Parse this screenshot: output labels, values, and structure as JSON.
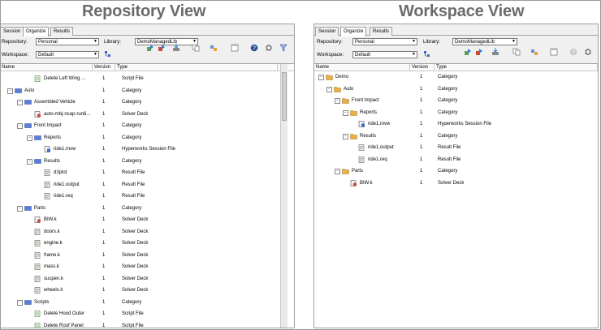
{
  "titles": {
    "left": "Repository View",
    "right": "Workspace View"
  },
  "tabs": [
    "Session",
    "Organize",
    "Results"
  ],
  "controls": {
    "repository_label": "Repository:",
    "repository_value": "Personal",
    "library_label": "Library:",
    "library_value": "DemoManagedLib",
    "workspace_label": "Workspace:",
    "workspace_value": "Default"
  },
  "columns": {
    "name": "Name",
    "version": "Version",
    "type": "Type"
  },
  "left_rows": [
    {
      "name": "Delete Left Wing ...",
      "version": "1",
      "type": "Script File",
      "icon": "script-icon",
      "level": 2
    },
    {
      "name": "Auto",
      "version": "1",
      "type": "Category",
      "icon": "category-icon",
      "level": 0
    },
    {
      "name": "Assembled Vehicle",
      "version": "1",
      "type": "Category",
      "icon": "category-icon",
      "level": 1
    },
    {
      "name": "auto-mbj-ncap-run6...",
      "version": "1",
      "type": "Solver Deck",
      "icon": "solver-deck-icon",
      "level": 2
    },
    {
      "name": "Front Impact",
      "version": "1",
      "type": "Category",
      "icon": "category-icon",
      "level": 1
    },
    {
      "name": "Reports",
      "version": "1",
      "type": "Category",
      "icon": "category-icon",
      "level": 2
    },
    {
      "name": "ride1.mvw",
      "version": "1",
      "type": "Hyperworks Session File",
      "icon": "session-file-icon",
      "level": 3
    },
    {
      "name": "Results",
      "version": "1",
      "type": "Category",
      "icon": "category-icon",
      "level": 2
    },
    {
      "name": "d3plot",
      "version": "1",
      "type": "Result File",
      "icon": "result-file-icon",
      "level": 3
    },
    {
      "name": "ride1.output",
      "version": "1",
      "type": "Result File",
      "icon": "result-file-icon",
      "level": 3
    },
    {
      "name": "ride1.req",
      "version": "1",
      "type": "Result File",
      "icon": "result-file-icon",
      "level": 3
    },
    {
      "name": "Parts",
      "version": "1",
      "type": "Category",
      "icon": "category-icon",
      "level": 1
    },
    {
      "name": "BIW.k",
      "version": "1",
      "type": "Solver Deck",
      "icon": "solver-deck-icon",
      "level": 2
    },
    {
      "name": "doors.k",
      "version": "1",
      "type": "Solver Deck",
      "icon": "result-file-icon",
      "level": 2
    },
    {
      "name": "engine.k",
      "version": "1",
      "type": "Solver Deck",
      "icon": "result-file-icon",
      "level": 2
    },
    {
      "name": "frame.k",
      "version": "1",
      "type": "Solver Deck",
      "icon": "result-file-icon",
      "level": 2
    },
    {
      "name": "mass.k",
      "version": "1",
      "type": "Solver Deck",
      "icon": "result-file-icon",
      "level": 2
    },
    {
      "name": "suspen.k",
      "version": "1",
      "type": "Solver Deck",
      "icon": "result-file-icon",
      "level": 2
    },
    {
      "name": "wheels.k",
      "version": "1",
      "type": "Solver Deck",
      "icon": "result-file-icon",
      "level": 2
    },
    {
      "name": "Scripts",
      "version": "1",
      "type": "Category",
      "icon": "category-icon",
      "level": 1
    },
    {
      "name": "Delete Hood Outer",
      "version": "1",
      "type": "Script File",
      "icon": "script-icon",
      "level": 2
    },
    {
      "name": "Delete Roof Panel",
      "version": "1",
      "type": "Script File",
      "icon": "script-icon",
      "level": 2
    }
  ],
  "right_rows": [
    {
      "name": "Demo",
      "version": "1",
      "type": "Category",
      "icon": "folder-icon",
      "level": 0
    },
    {
      "name": "Auto",
      "version": "1",
      "type": "Category",
      "icon": "folder-icon",
      "level": 1
    },
    {
      "name": "Front Impact",
      "version": "1",
      "type": "Category",
      "icon": "folder-icon",
      "level": 2
    },
    {
      "name": "Reports",
      "version": "1",
      "type": "Category",
      "icon": "folder-icon",
      "level": 3
    },
    {
      "name": "ride1.mvw",
      "version": "1",
      "type": "Hyperworks Session File",
      "icon": "session-file-icon",
      "level": 4
    },
    {
      "name": "Results",
      "version": "1",
      "type": "Category",
      "icon": "folder-icon",
      "level": 3
    },
    {
      "name": "ride1.output",
      "version": "1",
      "type": "Result File",
      "icon": "result-file-icon",
      "level": 4
    },
    {
      "name": "ride1.req",
      "version": "1",
      "type": "Result File",
      "icon": "result-file-icon",
      "level": 4
    },
    {
      "name": "Parts",
      "version": "1",
      "type": "Category",
      "icon": "folder-icon",
      "level": 2
    },
    {
      "name": "BIW.k",
      "version": "1",
      "type": "Solver Deck",
      "icon": "solver-deck-icon",
      "level": 3
    }
  ],
  "colors": {
    "title_gray": "#6b6b6b",
    "category_blue": "#5b7fd6",
    "folder_orange": "#e8b04a"
  }
}
